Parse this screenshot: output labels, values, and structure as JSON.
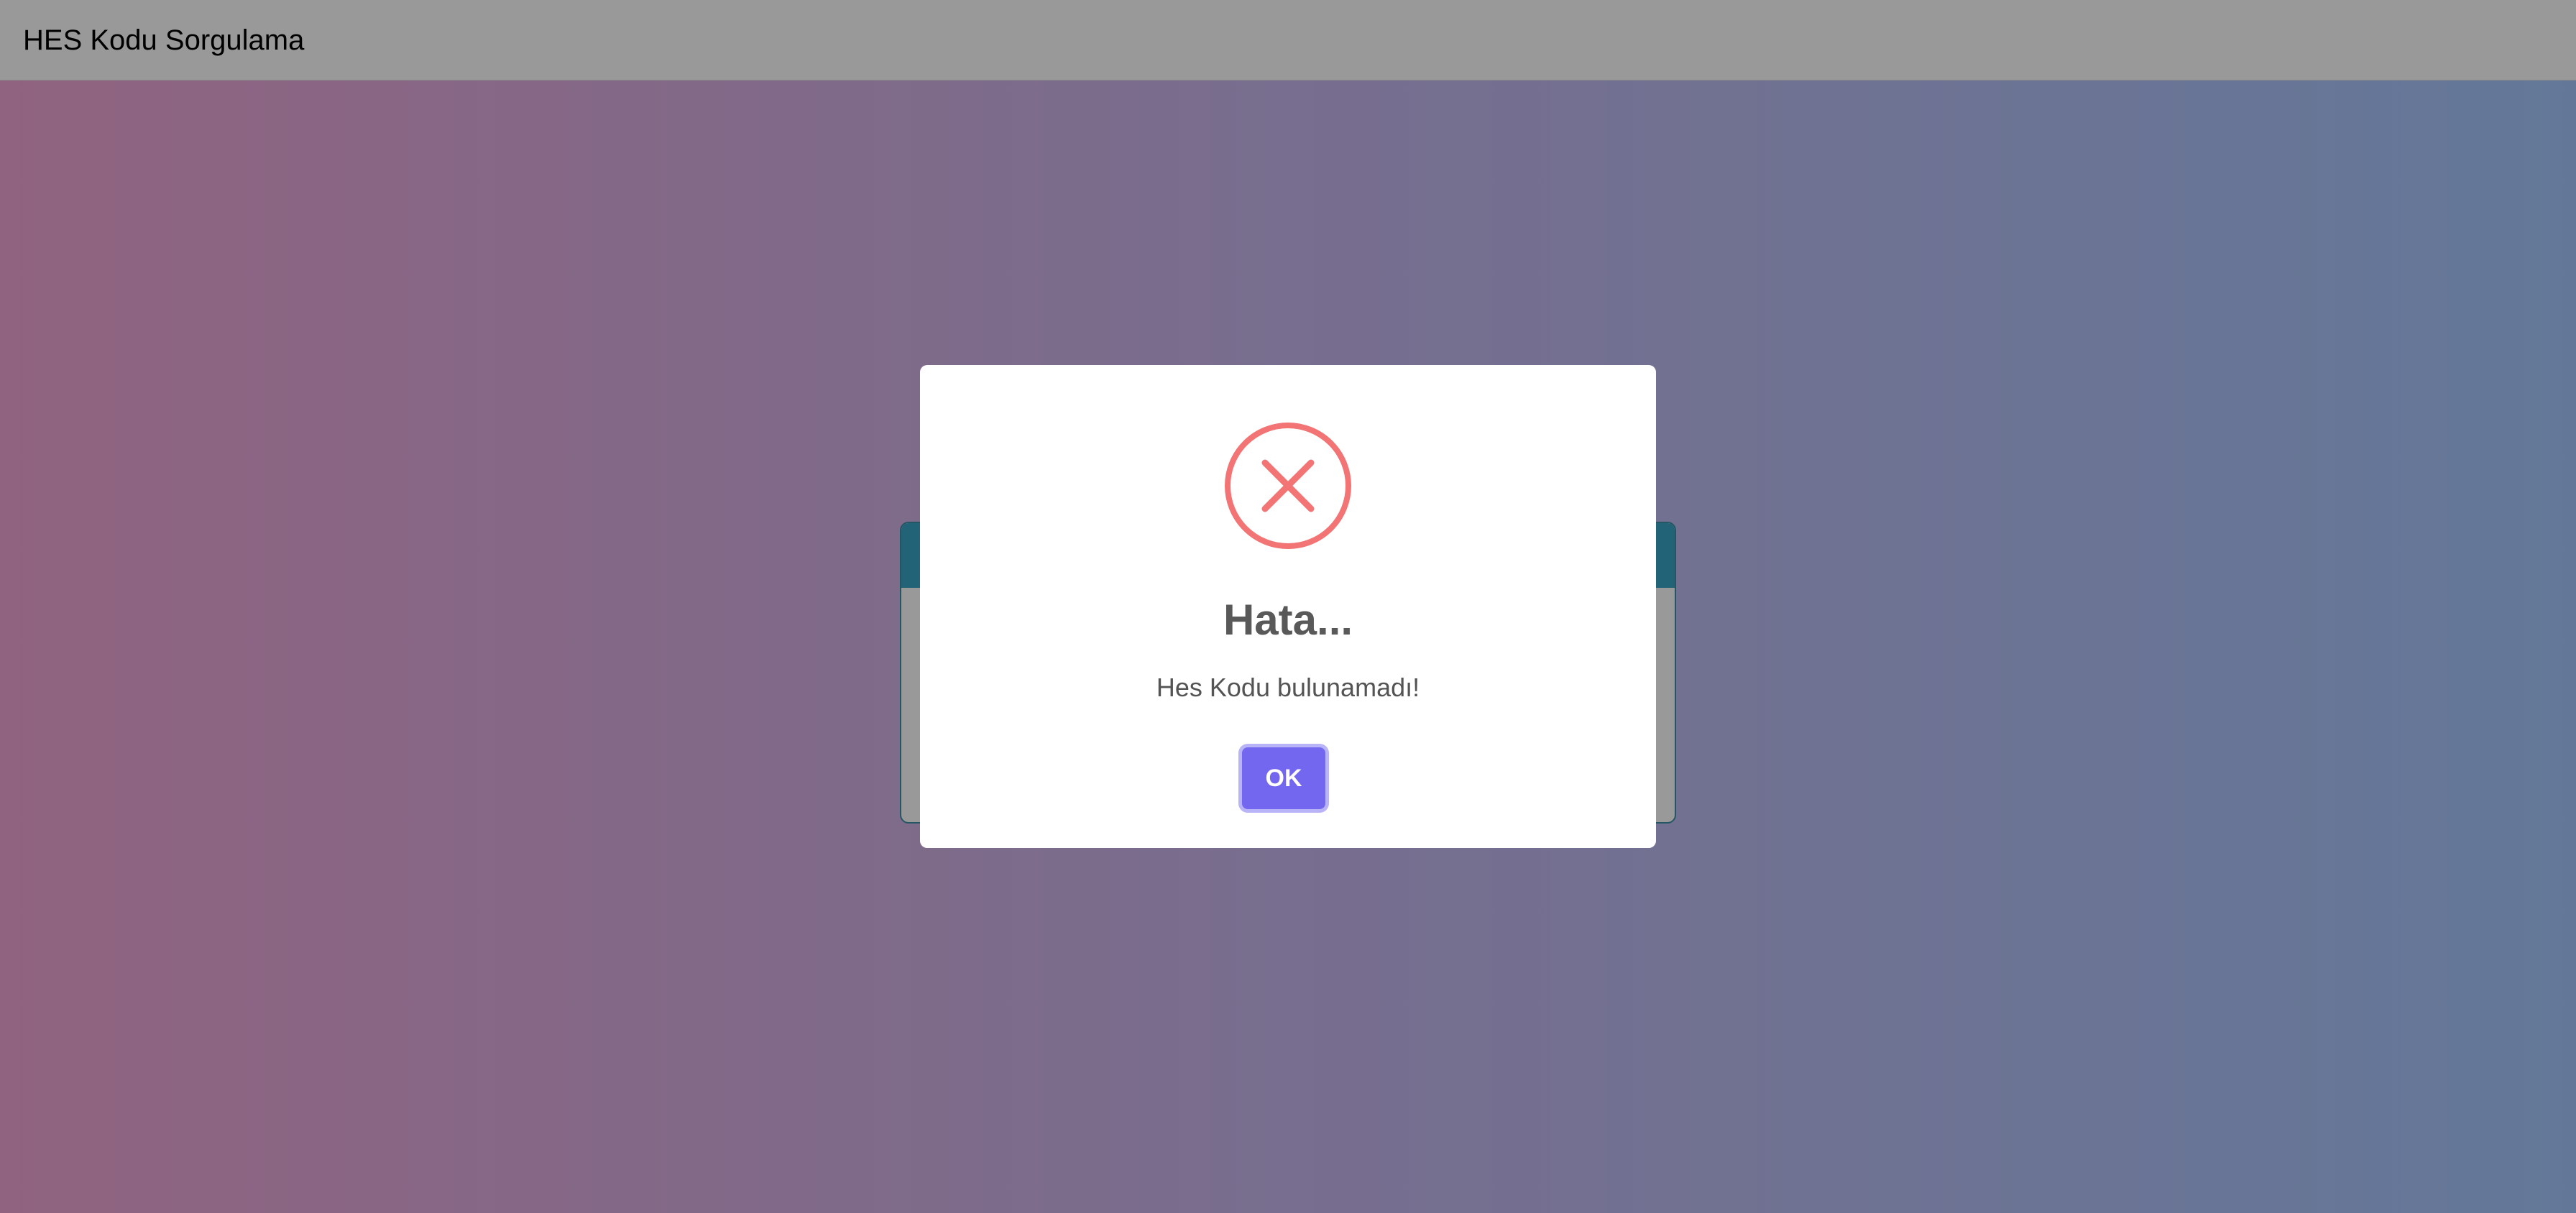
{
  "navbar": {
    "brand": "HES Kodu Sorgulama"
  },
  "alert": {
    "icon": "error-x-icon",
    "title": "Hata...",
    "message": "Hes Kodu bulunamadı!",
    "confirm_label": "OK"
  },
  "colors": {
    "error": "#f27474",
    "confirm_button": "#7367f0",
    "card_header": "#3aa6c8",
    "background_left": "#f0a6d6",
    "background_right": "#a6c8ff"
  }
}
